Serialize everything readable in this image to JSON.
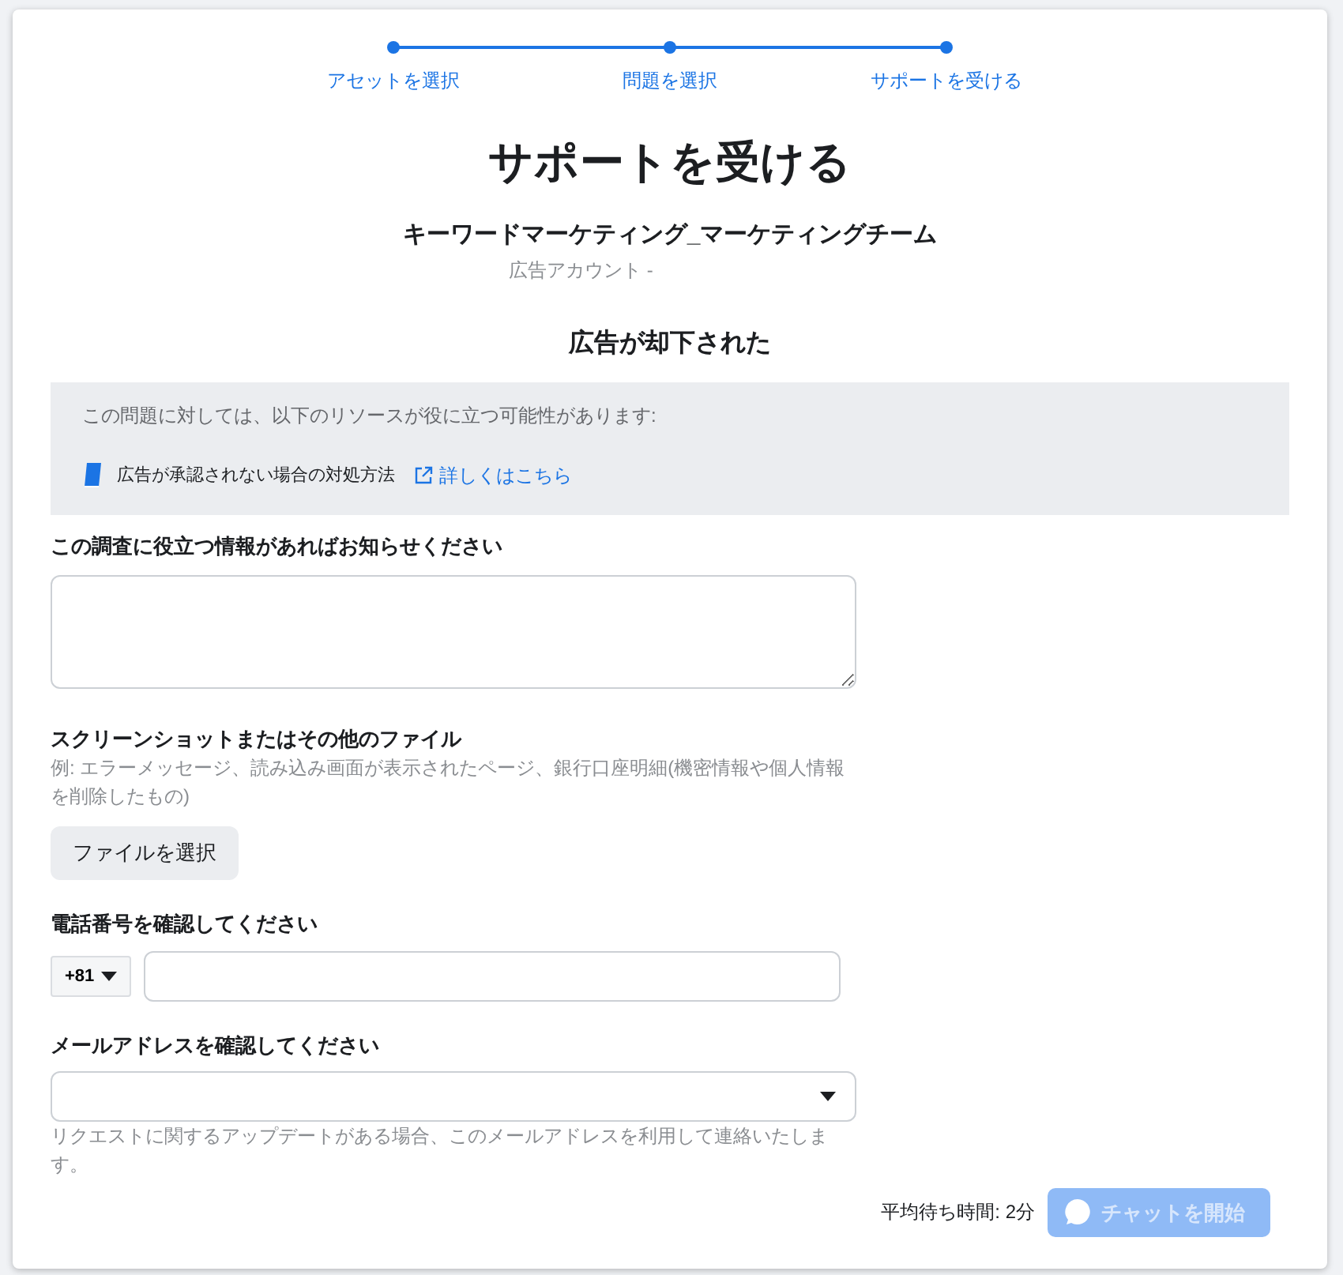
{
  "steps": [
    {
      "label": "アセットを選択",
      "done": true
    },
    {
      "label": "問題を選択",
      "done": true
    },
    {
      "label": "サポートを受ける",
      "done": true
    }
  ],
  "title": "サポートを受ける",
  "account": {
    "name": "キーワードマーケティング_マーケティングチーム",
    "subtitle": "広告アカウント -"
  },
  "issue": "広告が却下された",
  "resources": {
    "intro": "この問題に対しては、以下のリソースが役に立つ可能性があります:",
    "items": [
      {
        "title": "広告が承認されない場合の対処方法",
        "link": "詳しくはこちら"
      }
    ]
  },
  "details": {
    "label": "この調査に役立つ情報があればお知らせください"
  },
  "files": {
    "label": "スクリーンショットまたはその他のファイル",
    "hint": "例: エラーメッセージ、読み込み画面が表示されたページ、銀行口座明細(機密情報や個人情報を削除したもの)",
    "button": "ファイルを選択"
  },
  "phone": {
    "label": "電話番号を確認してください",
    "country_code": "+81"
  },
  "email": {
    "label": "メールアドレスを確認してください",
    "hint": "リクエストに関するアップデートがある場合、このメールアドレスを利用して連絡いたします。"
  },
  "footer": {
    "wait": "平均待ち時間: 2分",
    "chat_button": "チャットを開始",
    "chat_disabled": true
  }
}
